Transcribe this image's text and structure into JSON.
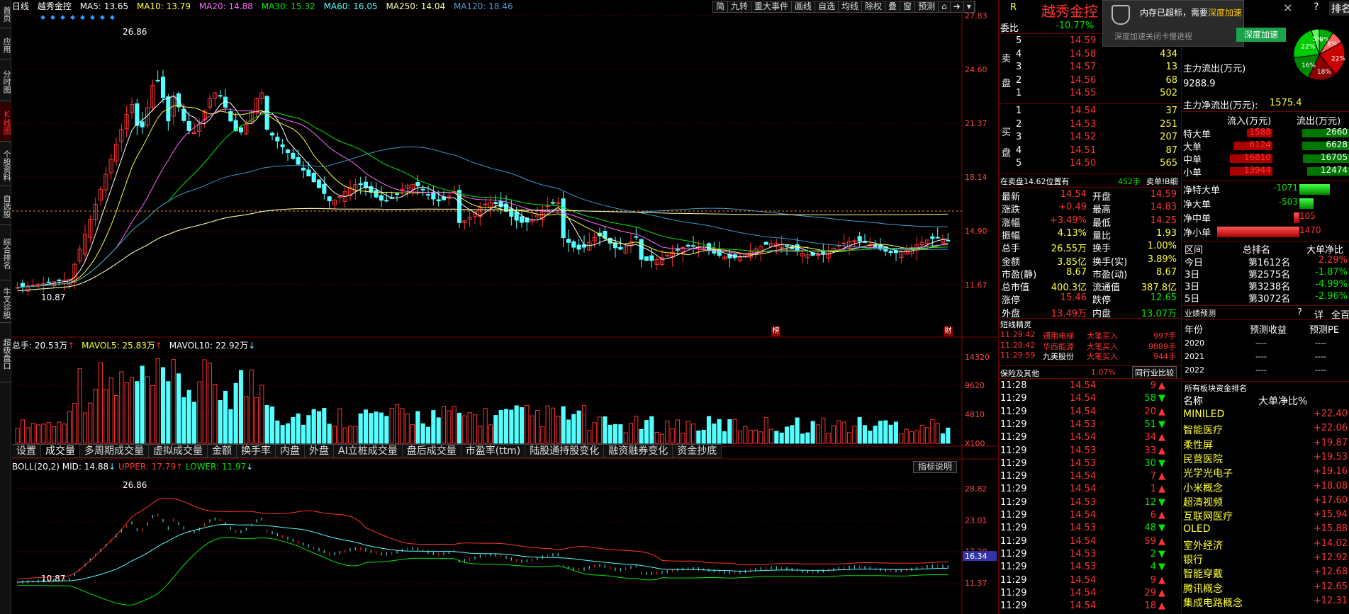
{
  "sidebar": [
    "首页",
    "应用",
    "分时图",
    "K线图",
    "个股资料",
    "自选股",
    "综合排名",
    "牛叉诊股",
    "超级盘口"
  ],
  "ma_bar": {
    "period": "日线",
    "stock_name": "越秀金控",
    "ma5": "MA5: 13.65",
    "ma10": "MA10: 13.79",
    "ma20": "MA20: 14.88",
    "ma30": "MA30: 15.32",
    "ma60": "MA60: 16.05",
    "ma250": "MA250: 14.04",
    "ma120": "MA120: 18.46"
  },
  "toolbar": [
    "简",
    "九转",
    "重大事件",
    "画线",
    "自选",
    "均线",
    "除权",
    "叠",
    "窗",
    "预测"
  ],
  "price_axis": [
    "27.83",
    "24.60",
    "21.37",
    "18.14",
    "14.90",
    "11.67"
  ],
  "price_labels": {
    "high": "26.86",
    "low": "10.87"
  },
  "markers": {
    "bang": "榜",
    "cai": "财"
  },
  "volume_bar": {
    "total": "总手: 20.53万",
    "mavol5": "MAVOL5: 25.83万",
    "mavol10": "MAVOL10: 22.92万"
  },
  "volume_axis": [
    "14320",
    "9620",
    "4810",
    "X100"
  ],
  "indicator_tabs": [
    "设置",
    "成交量",
    "多周期成交量",
    "虚拟成交量",
    "金额",
    "换手率",
    "内盘",
    "外盘",
    "AI立桩成交量",
    "盘后成交量",
    "市盈率(ttm)",
    "陆股通持股变化",
    "融资融券变化",
    "资金抄底"
  ],
  "boll_bar": {
    "label": "BOLL(20,2)",
    "mid": "MID: 14.88",
    "upper": "UPPER: 17.79",
    "lower": "LOWER: 11.97",
    "explain": "指标说明"
  },
  "boll_axis": [
    "28.82",
    "23.01",
    "17.20",
    "16.34",
    "11.37"
  ],
  "boll_labels": {
    "high": "26.86",
    "low": "10.87"
  },
  "quote": {
    "r_label": "R",
    "name": "越秀金控",
    "weibi_label": "委比",
    "weibi": "-10.77%",
    "sell_label": "卖盘",
    "buy_label": "买盘",
    "asks": [
      {
        "lvl": "5",
        "price": "14.59",
        "vol": "",
        "c": "red"
      },
      {
        "lvl": "4",
        "price": "14.58",
        "vol": "434",
        "c": "red"
      },
      {
        "lvl": "3",
        "price": "14.57",
        "vol": "13",
        "c": "red"
      },
      {
        "lvl": "2",
        "price": "14.56",
        "vol": "68",
        "c": "red"
      },
      {
        "lvl": "1",
        "price": "14.55",
        "vol": "502",
        "c": "red"
      }
    ],
    "bids": [
      {
        "lvl": "1",
        "price": "14.54",
        "vol": "37",
        "c": "red"
      },
      {
        "lvl": "2",
        "price": "14.53",
        "vol": "251",
        "c": "red"
      },
      {
        "lvl": "3",
        "price": "14.52",
        "vol": "207",
        "c": "red"
      },
      {
        "lvl": "4",
        "price": "14.51",
        "vol": "87",
        "c": "red"
      },
      {
        "lvl": "5",
        "price": "14.50",
        "vol": "565",
        "c": "red"
      }
    ],
    "position_note": "在卖盘14.62位置有",
    "position_vol": "452手",
    "position_action": "卖单!",
    "position_btn": "B细",
    "stats_left": [
      [
        "最新",
        "14.54"
      ],
      [
        "涨跌",
        "+0.49"
      ],
      [
        "涨幅",
        "+3.49%"
      ],
      [
        "振幅",
        "4.13%"
      ],
      [
        "总手",
        "26.55万"
      ],
      [
        "金额",
        "3.85亿"
      ],
      [
        "市盈(静)",
        "8.67"
      ],
      [
        "总市值",
        "400.3亿"
      ],
      [
        "涨停",
        "15.46"
      ],
      [
        "外盘",
        "13.49万"
      ]
    ],
    "stats_right": [
      [
        "开盘",
        "14.59"
      ],
      [
        "最高",
        "14.83"
      ],
      [
        "最低",
        "14.25"
      ],
      [
        "量比",
        "1.93"
      ],
      [
        "换手",
        "1.00%"
      ],
      [
        "换手(实)",
        "3.89%"
      ],
      [
        "市盈(动)",
        "8.67"
      ],
      [
        "流通值",
        "387.8亿"
      ],
      [
        "跌停",
        "12.65"
      ],
      [
        "内盘",
        "13.07万"
      ]
    ],
    "short_title": "短线精灵",
    "shorts": [
      [
        "11:29:42",
        "通用电梯",
        "大笔买入",
        "997手"
      ],
      [
        "11:29:42",
        "华西能源",
        "大笔买入",
        "9889手"
      ],
      [
        "11:29:59",
        "九美股份",
        "大笔买入",
        "944手"
      ]
    ],
    "industry_name": "保险及其他",
    "industry_change": "1.07%",
    "industry_btn": "同行业比较",
    "ticks": [
      [
        "11:28",
        "14.54",
        "9",
        "r"
      ],
      [
        "11:29",
        "14.54",
        "58",
        "g"
      ],
      [
        "11:29",
        "14.54",
        "20",
        "r"
      ],
      [
        "11:29",
        "14.53",
        "51",
        "g"
      ],
      [
        "11:29",
        "14.54",
        "34",
        "r"
      ],
      [
        "11:29",
        "14.53",
        "33",
        "r"
      ],
      [
        "11:29",
        "14.53",
        "30",
        "g"
      ],
      [
        "11:29",
        "14.54",
        "7",
        "r"
      ],
      [
        "11:29",
        "14.54",
        "1",
        "r"
      ],
      [
        "11:29",
        "14.53",
        "12",
        "g"
      ],
      [
        "11:29",
        "14.54",
        "6",
        "r"
      ],
      [
        "11:29",
        "14.53",
        "48",
        "g"
      ],
      [
        "11:29",
        "14.54",
        "59",
        "r"
      ],
      [
        "11:29",
        "14.53",
        "2",
        "g"
      ],
      [
        "11:29",
        "14.53",
        "4",
        "g"
      ],
      [
        "11:29",
        "14.54",
        "9",
        "r"
      ],
      [
        "11:29",
        "14.54",
        "29",
        "r"
      ],
      [
        "11:29",
        "14.54",
        "18",
        "r"
      ]
    ]
  },
  "fund": {
    "popup_title": "内存已超标，需要",
    "popup_link": "深度加速",
    "popup_sub": "深度加速关闭卡慢进程",
    "popup_btn": "深度加速",
    "popup_close": "×",
    "rank_btn": "排名",
    "help": "?",
    "pie": [
      {
        "label": "9%",
        "v": 9,
        "color": "#00aa00"
      },
      {
        "label": "8%",
        "v": 8,
        "color": "#ff6666"
      },
      {
        "label": "22%",
        "v": 22,
        "color": "#cc0000"
      },
      {
        "label": "18%",
        "v": 18,
        "color": "#880000"
      },
      {
        "label": "16%",
        "v": 16,
        "color": "#008800"
      },
      {
        "label": "22%",
        "v": 22,
        "color": "#00cc00"
      },
      {
        "label": "5%",
        "v": 5,
        "color": "#55ff55"
      }
    ],
    "main_out_label": "主力流出(万元)",
    "main_out": "9288.9",
    "net_label": "主力净流出(万元):",
    "net": "1575.4",
    "in_label": "流入(万元)",
    "out_label": "流出(万元)",
    "flows": [
      {
        "name": "特大单",
        "in": "1588",
        "out": "2660",
        "inw": 0.6,
        "outw": 1.0
      },
      {
        "name": "大单",
        "in": "6124",
        "out": "6628",
        "inw": 0.92,
        "outw": 1.0
      },
      {
        "name": "中单",
        "in": "16810",
        "out": "16705",
        "inw": 1.0,
        "outw": 0.99
      },
      {
        "name": "小单",
        "in": "13944",
        "out": "12474",
        "inw": 1.0,
        "outw": 0.89
      }
    ],
    "nets": [
      {
        "name": "净特大单",
        "v": "-1071",
        "side": "g",
        "w": 0.72
      },
      {
        "name": "净大单",
        "v": "-503",
        "side": "g",
        "w": 0.34
      },
      {
        "name": "净中单",
        "v": "105",
        "side": "r",
        "w": 0.07
      },
      {
        "name": "净小单",
        "v": "1470",
        "side": "r",
        "w": 1.0
      }
    ],
    "period_label": "区间",
    "rank_label": "总排名",
    "ratio_label": "大单净比",
    "periods": [
      [
        "今日",
        "第1612名",
        "2.29%",
        "r"
      ],
      [
        "3日",
        "第2575名",
        "-1.87%",
        "g"
      ],
      [
        "3日",
        "第3238名",
        "-4.99%",
        "g"
      ],
      [
        "5日",
        "第3072名",
        "-2.96%",
        "g"
      ]
    ],
    "forecast_title": "业绩预测",
    "forecast_q": "?",
    "forecast_d": "详",
    "forecast_a": "全百",
    "year_label": "年份",
    "eps_label": "预测收益",
    "pe_label": "预测PE",
    "forecast": [
      [
        "2020",
        "----",
        "----"
      ],
      [
        "2021",
        "----",
        "----"
      ],
      [
        "2022",
        "----",
        "----"
      ]
    ],
    "sector_title": "所有板块资金排名",
    "sector_name": "名称",
    "sector_ratio": "大单净比%",
    "sectors": [
      [
        "MINILED",
        "+22.40"
      ],
      [
        "智能医疗",
        "+22.06"
      ],
      [
        "柔性屏",
        "+19.87"
      ],
      [
        "民营医院",
        "+19.53"
      ],
      [
        "光学光电子",
        "+19.16"
      ],
      [
        "小米概念",
        "+18.08"
      ],
      [
        "超清视频",
        "+17.60"
      ],
      [
        "互联网医疗",
        "+15.94"
      ],
      [
        "OLED",
        "+15.88"
      ],
      [
        "室外经济",
        "+14.02"
      ],
      [
        "银行",
        "+12.92"
      ],
      [
        "智能穿戴",
        "+12.68"
      ],
      [
        "腾讯概念",
        "+12.65"
      ],
      [
        "集成电路概念",
        "+12.31"
      ]
    ]
  }
}
